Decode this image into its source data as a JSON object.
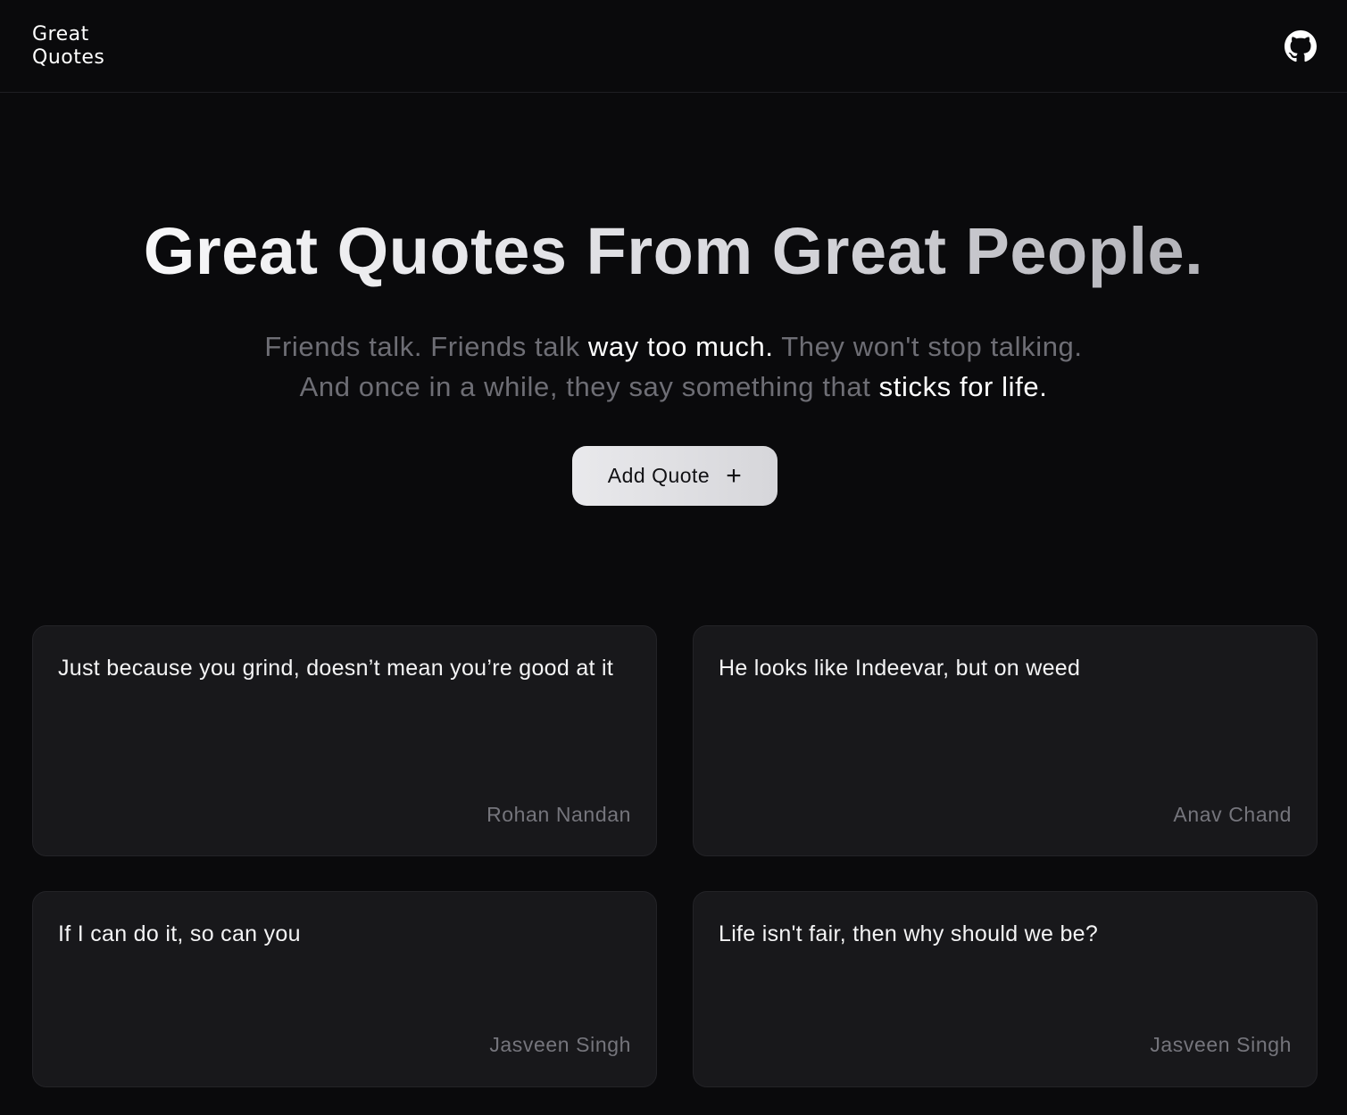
{
  "nav": {
    "logo_line1": "Great",
    "logo_line2": "Quotes",
    "github_icon": "github-icon"
  },
  "hero": {
    "title": "Great Quotes From Great People.",
    "subtitle": {
      "part1": "Friends talk. Friends talk ",
      "highlight1": "way too much.",
      "part2": " They won't stop talking.",
      "part3": "And once in a while, they say something that ",
      "highlight2": "sticks for life."
    },
    "add_button_label": "Add Quote",
    "add_button_icon": "plus-icon"
  },
  "quotes": [
    {
      "text": "Just because you grind, doesn’t mean you’re good at it",
      "author": "Rohan Nandan"
    },
    {
      "text": "He looks like Indeevar, but on weed",
      "author": "Anav Chand"
    },
    {
      "text": "If I can do it, so can you",
      "author": "Jasveen Singh"
    },
    {
      "text": "Life isn't fair, then why should we be?",
      "author": "Jasveen Singh"
    }
  ],
  "colors": {
    "background": "#0a0a0c",
    "card": "#18181b",
    "muted_text": "#6e6e75",
    "button": "#e2e2e5"
  }
}
